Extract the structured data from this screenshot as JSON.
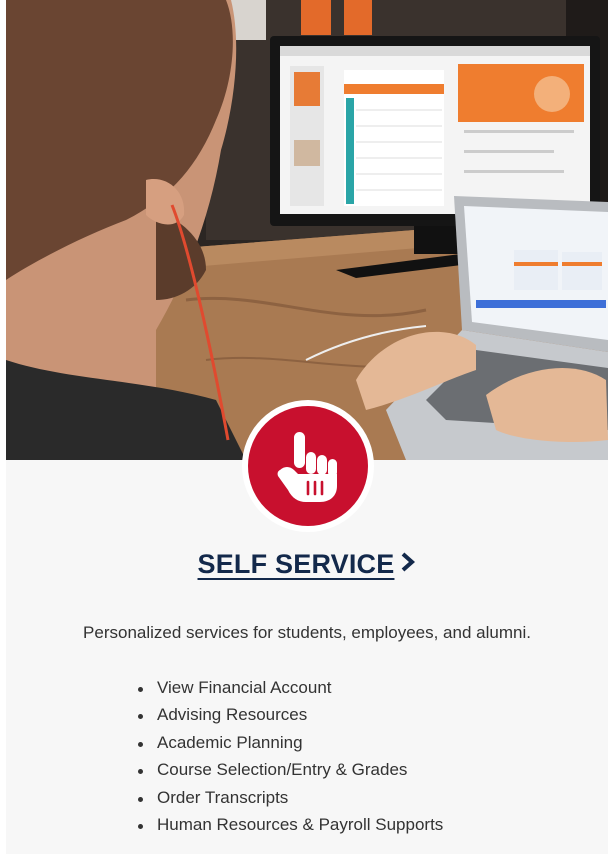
{
  "self_service": {
    "title": "SELF SERVICE",
    "description": "Personalized services for students, employees, and alumni.",
    "items": [
      "View Financial Account",
      "Advising Resources",
      "Academic Planning",
      "Course Selection/Entry & Grades",
      "Order Transcripts",
      "Human Resources & Payroll Supports"
    ]
  },
  "icons": {
    "badge": "pointing-hand-icon",
    "title_arrow": "chevron-right-icon"
  },
  "colors": {
    "badge_red": "#c8102e",
    "title_navy": "#13294b",
    "text": "#333333",
    "card_bg": "#f7f7f7"
  }
}
